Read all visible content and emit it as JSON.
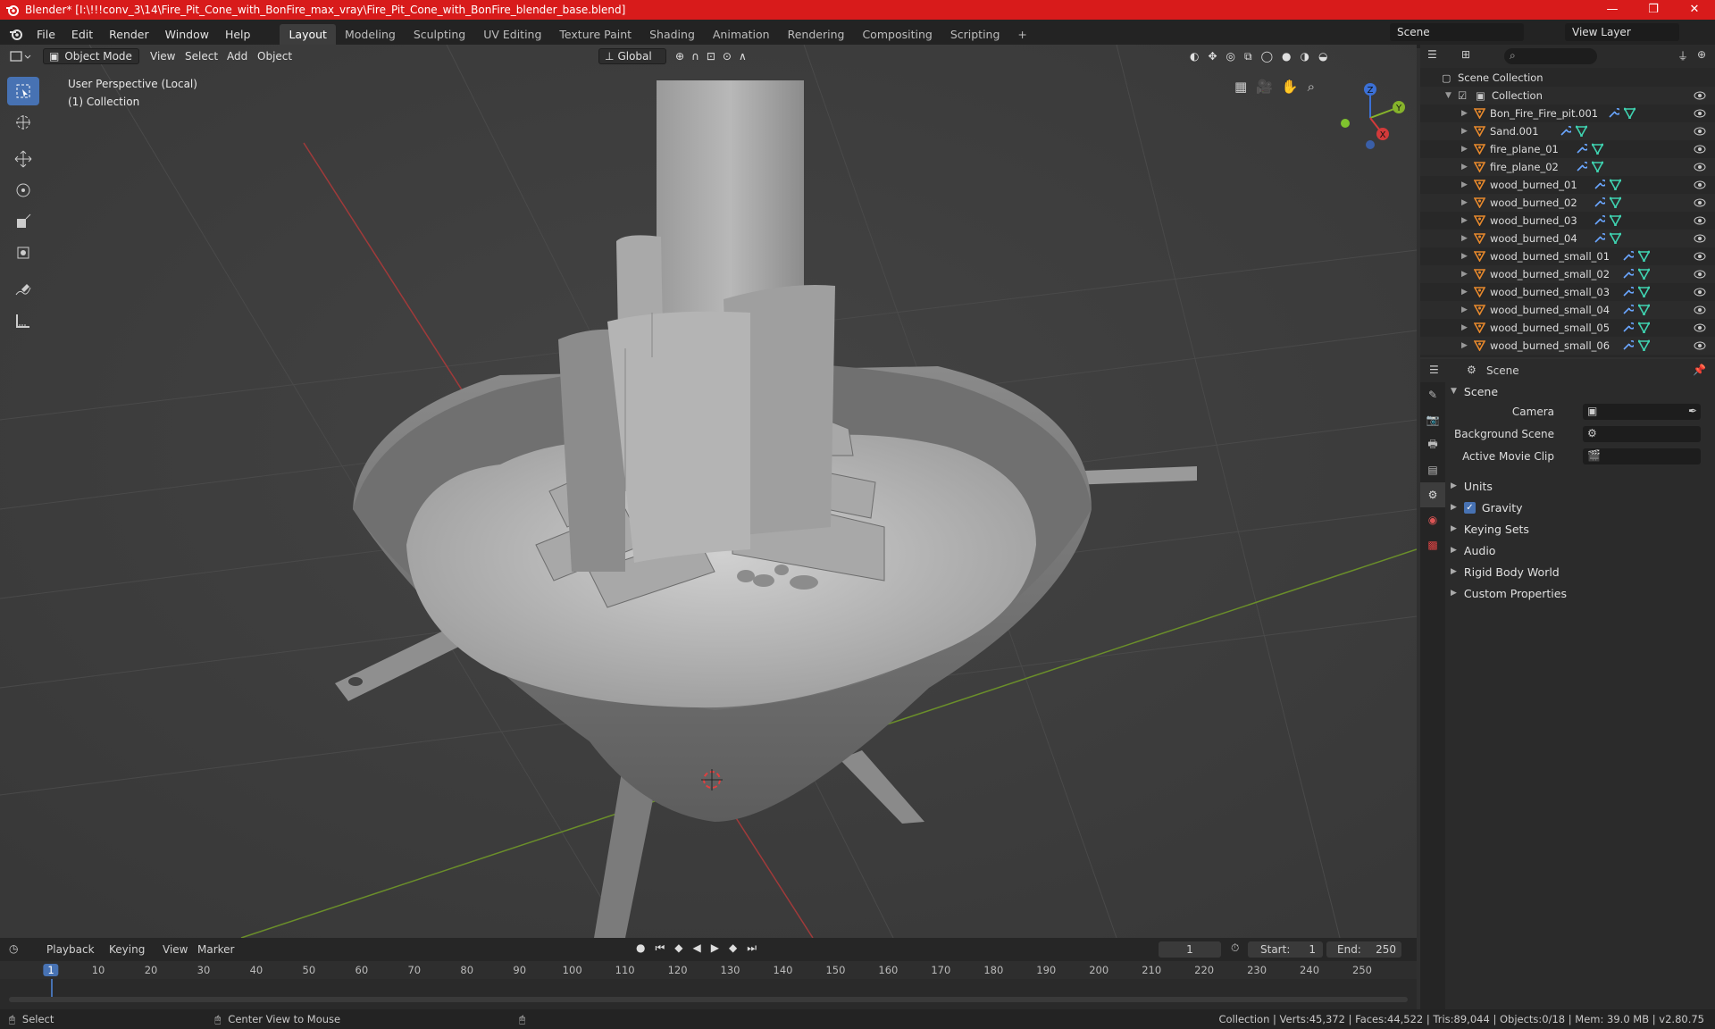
{
  "titlebar": {
    "title": "Blender* [I:\\!!!conv_3\\14\\Fire_Pit_Cone_with_BonFire_max_vray\\Fire_Pit_Cone_with_BonFire_blender_base.blend]",
    "minimize": "—",
    "maximize": "❐",
    "close": "✕"
  },
  "menubar": {
    "menus": [
      "File",
      "Edit",
      "Render",
      "Window",
      "Help"
    ],
    "workspaces": [
      "Layout",
      "Modeling",
      "Sculpting",
      "UV Editing",
      "Texture Paint",
      "Shading",
      "Animation",
      "Rendering",
      "Compositing",
      "Scripting"
    ],
    "active_workspace": "Layout",
    "add_tab": "+",
    "scene": "Scene",
    "view_layer": "View Layer"
  },
  "viewport": {
    "mode": "Object Mode",
    "menus": [
      "View",
      "Select",
      "Add",
      "Object"
    ],
    "orientation": "Global",
    "perspective_label": "User Perspective (Local)",
    "collection_label": "(1) Collection",
    "gizmo_axes": [
      "Z",
      "Y",
      "X"
    ]
  },
  "outliner": {
    "root": "Scene Collection",
    "collection": "Collection",
    "items": [
      "Bon_Fire_Fire_pit.001",
      "Sand.001",
      "fire_plane_01",
      "fire_plane_02",
      "wood_burned_01",
      "wood_burned_02",
      "wood_burned_03",
      "wood_burned_04",
      "wood_burned_small_01",
      "wood_burned_small_02",
      "wood_burned_small_03",
      "wood_burned_small_04",
      "wood_burned_small_05",
      "wood_burned_small_06"
    ]
  },
  "properties": {
    "header": "Scene",
    "panel_title": "Scene",
    "camera_label": "Camera",
    "background_scene_label": "Background Scene",
    "active_movie_clip_label": "Active Movie Clip",
    "subpanels": [
      "Units",
      "Gravity",
      "Keying Sets",
      "Audio",
      "Rigid Body World",
      "Custom Properties"
    ],
    "gravity_checked": true
  },
  "timeline": {
    "menus": [
      "Playback",
      "Keying",
      "View",
      "Marker"
    ],
    "current_frame": "1",
    "start_label": "Start:",
    "start": "1",
    "end_label": "End:",
    "end": "250",
    "ruler": [
      "1",
      "10",
      "20",
      "30",
      "40",
      "50",
      "60",
      "70",
      "80",
      "90",
      "100",
      "110",
      "120",
      "130",
      "140",
      "150",
      "160",
      "170",
      "180",
      "190",
      "200",
      "210",
      "220",
      "230",
      "240",
      "250"
    ]
  },
  "statusbar": {
    "select": "Select",
    "center_view": "Center View to Mouse",
    "stats": "Collection | Verts:45,372 | Faces:44,522 | Tris:89,044 | Objects:0/18 | Mem: 39.0 MB | v2.80.75"
  },
  "colors": {
    "accent": "#4772b3",
    "titlebar": "#d81b1b",
    "object_icon": "#e8892c",
    "mesh_icon": "#3fd2b0",
    "modifier_icon": "#6aa6ff"
  }
}
